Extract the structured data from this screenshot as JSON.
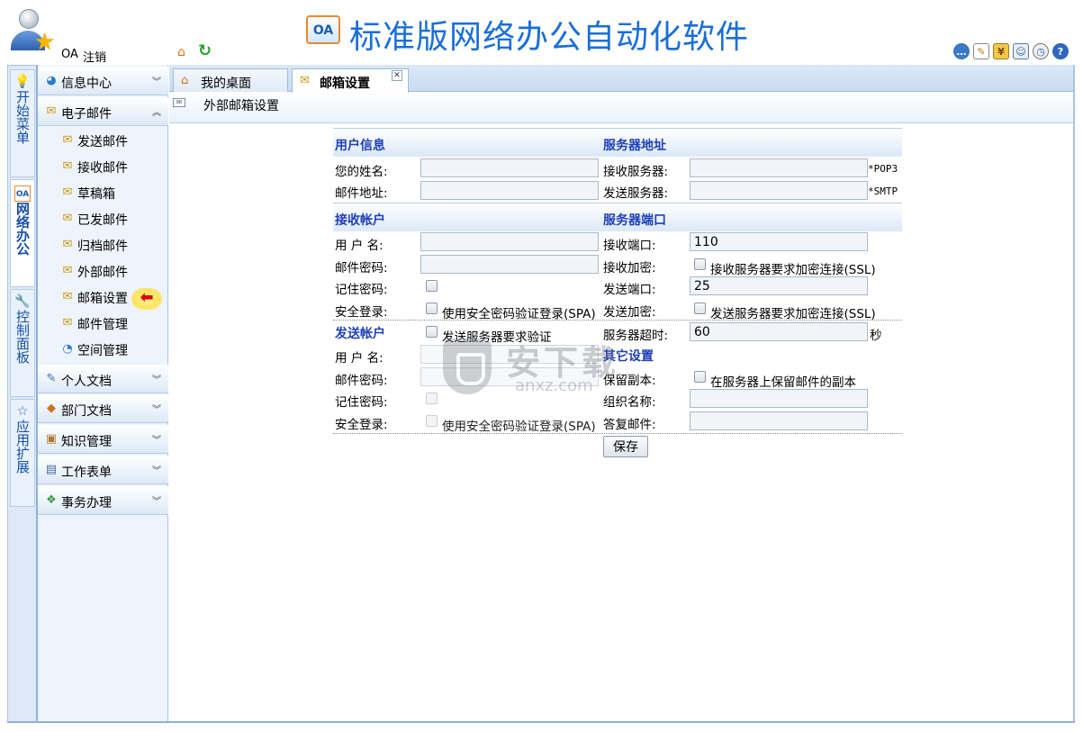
{
  "header": {
    "user_label": "OA",
    "logout_label": "注销",
    "logo_text": "OA",
    "title": "标准版网络办公自动化软件",
    "tool_icons": [
      "chat-icon",
      "edit-note-icon",
      "finance-icon",
      "contacts-icon",
      "alarm-clock-icon",
      "help-icon"
    ],
    "tool_glyphs": {
      "yen": "¥",
      "help": "?"
    }
  },
  "vertical_tabs": [
    {
      "label": "开始菜单",
      "icon": "lightbulb-icon"
    },
    {
      "label": "网络办公",
      "icon": "oa-icon"
    },
    {
      "label": "控制面板",
      "icon": "wrench-icon"
    },
    {
      "label": "应用扩展",
      "icon": "star-icon"
    }
  ],
  "menu": {
    "groups": [
      {
        "label": "信息中心",
        "icon": "globe-icon"
      },
      {
        "label": "电子邮件",
        "icon": "mail-folder-icon"
      },
      {
        "label": "个人文档",
        "icon": "document-pen-icon"
      },
      {
        "label": "部门文档",
        "icon": "department-icon"
      },
      {
        "label": "知识管理",
        "icon": "knowledge-box-icon"
      },
      {
        "label": "工作表单",
        "icon": "form-icon"
      },
      {
        "label": "事务办理",
        "icon": "task-icon"
      }
    ],
    "email_items": [
      {
        "label": "发送邮件"
      },
      {
        "label": "接收邮件"
      },
      {
        "label": "草稿箱"
      },
      {
        "label": "已发邮件"
      },
      {
        "label": "归档邮件"
      },
      {
        "label": "外部邮件"
      },
      {
        "label": "邮箱设置"
      },
      {
        "label": "邮件管理"
      },
      {
        "label": "空间管理"
      }
    ],
    "pointer_glyph": "⬅"
  },
  "tabs": [
    {
      "label": "我的桌面"
    },
    {
      "label": "邮箱设置"
    }
  ],
  "close_glyph": "✕",
  "page_title": "外部邮箱设置",
  "form": {
    "user_info": {
      "title": "用户信息",
      "name_label": "您的姓名:",
      "name_value": "",
      "email_label": "邮件地址:",
      "email_value": ""
    },
    "server_address": {
      "title": "服务器地址",
      "incoming_label": "接收服务器:",
      "incoming_value": "",
      "incoming_hint": "*POP3",
      "outgoing_label": "发送服务器:",
      "outgoing_value": "",
      "outgoing_hint": "*SMTP"
    },
    "receive_account": {
      "title": "接收帐户",
      "username_label": "用 户 名:",
      "username_value": "",
      "password_label": "邮件密码:",
      "password_value": "",
      "remember_label": "记住密码:",
      "secure_label": "安全登录:",
      "spa_text": "使用安全密码验证登录(SPA)"
    },
    "server_port": {
      "title": "服务器端口",
      "recv_port_label": "接收端口:",
      "recv_port_value": "110",
      "recv_encrypt_label": "接收加密:",
      "recv_ssl_text": "接收服务器要求加密连接(SSL)",
      "send_port_label": "发送端口:",
      "send_port_value": "25",
      "send_encrypt_label": "发送加密:",
      "send_ssl_text": "发送服务器要求加密连接(SSL)",
      "timeout_label": "服务器超时:",
      "timeout_value": "60",
      "timeout_unit": "秒"
    },
    "send_account": {
      "title": "发送帐户",
      "require_auth_text": "发送服务器要求验证",
      "username_label": "用 户 名:",
      "username_value": "",
      "password_label": "邮件密码:",
      "password_value": "",
      "remember_label": "记住密码:",
      "secure_label": "安全登录:",
      "spa_text": "使用安全密码验证登录(SPA)"
    },
    "other_settings": {
      "title": "其它设置",
      "keep_copy_label": "保留副本:",
      "keep_copy_text": "在服务器上保留邮件的副本",
      "org_name_label": "组织名称:",
      "org_name_value": "",
      "reply_label": "答复邮件:",
      "reply_value": ""
    },
    "save_label": "保存"
  },
  "watermark": {
    "text": "安下载",
    "sub": "anxz.com"
  },
  "colors": {
    "accent": "#1a6fd8",
    "section_title": "#1f3fb8",
    "panel_bg": "#eef4fb",
    "border": "#a9c3e3"
  }
}
